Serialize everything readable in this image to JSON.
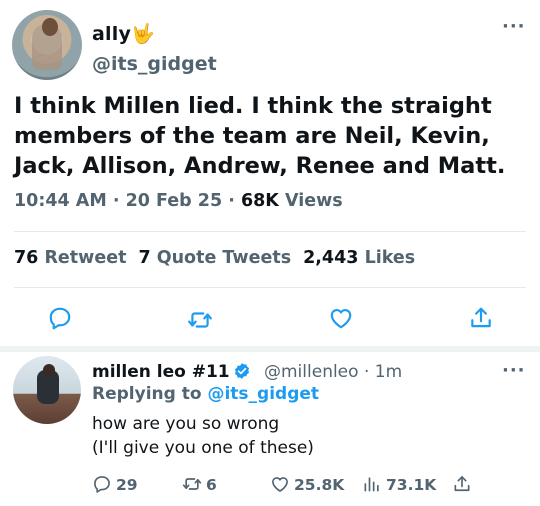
{
  "main_tweet": {
    "display_name": "ally🤟",
    "handle": "@its_gidget",
    "text_line1": "I think Millen lied. I think the straight",
    "text_line2": "members of the team are Neil, Kevin,",
    "text_line3": "Jack, Allison, Andrew, Renee and Matt.",
    "time": "10:44 AM · 20 Feb 25 · ",
    "views_count": "68K",
    "views_label": " Views",
    "retweets_count": "76",
    "retweets_label": "Retweet",
    "quote_count": "7",
    "quote_label": "Quote Tweets",
    "likes_count": "2,443",
    "likes_label": "Likes",
    "more": "···"
  },
  "reply": {
    "display_name": "millen leo #11",
    "handle_time": "@millenleo · 1m",
    "replying_prefix": "Replying to ",
    "replying_mention": "@its_gidget",
    "text_line1": "how are you so wrong",
    "text_line2": "(I'll give you one of these)",
    "reply_count": "29",
    "retweet_count": "6",
    "like_count": "25.8K",
    "view_count": "73.1K",
    "more": "···"
  },
  "colors": {
    "accent": "#1d9bf0",
    "secondary_text": "#536471",
    "primary_text": "#0f1419"
  }
}
